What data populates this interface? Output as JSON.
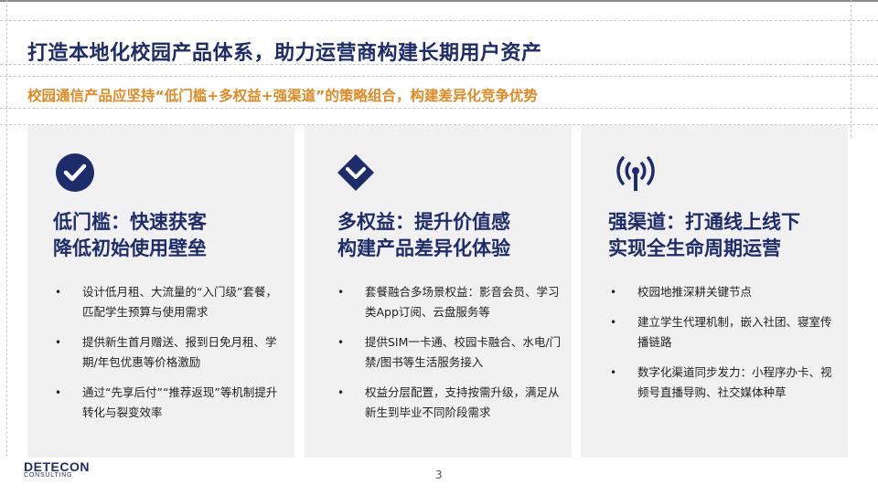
{
  "slide": {
    "title": "打造本地化校园产品体系，助力运营商构建长期用户资产",
    "subtitle": "校园通信产品应坚持“低门槛+多权益+强渠道”的策略组合，构建差异化竞争优势",
    "page_number": "3"
  },
  "cards": [
    {
      "icon": "check-circle-icon",
      "heading_line1": "低门槛：快速获客",
      "heading_line2": "降低初始使用壁垒",
      "bullets": [
        "设计低月租、大流量的“入门级”套餐，匹配学生预算与使用需求",
        "提供新生首月赠送、报到日免月租、学期/年包优惠等价格激励",
        "通过“先享后付”“推荐返现”等机制提升转化与裂变效率"
      ]
    },
    {
      "icon": "diamond-badge-icon",
      "heading_line1": "多权益：提升价值感",
      "heading_line2": "构建产品差异化体验",
      "bullets": [
        "套餐融合多场景权益：影音会员、学习类App订阅、云盘服务等",
        "提供SIM一卡通、校园卡融合、水电/门禁/图书等生活服务接入",
        "权益分层配置，支持按需升级，满足从新生到毕业不同阶段需求"
      ]
    },
    {
      "icon": "signal-tower-icon",
      "heading_line1": "强渠道：打通线上线下",
      "heading_line2": "实现全生命周期运营",
      "bullets": [
        "校园地推深耕关键节点",
        "建立学生代理机制，嵌入社团、寝室传播链路",
        "数字化渠道同步发力：小程序办卡、视频号直播导购、社交媒体种草"
      ]
    }
  ],
  "logo": {
    "main": "DETECON",
    "sub": "CONSULTING"
  },
  "colors": {
    "navy": "#1d2d6b",
    "orange": "#e08a23",
    "card_bg": "#f1f1f1"
  },
  "bullet_symbol": "•"
}
